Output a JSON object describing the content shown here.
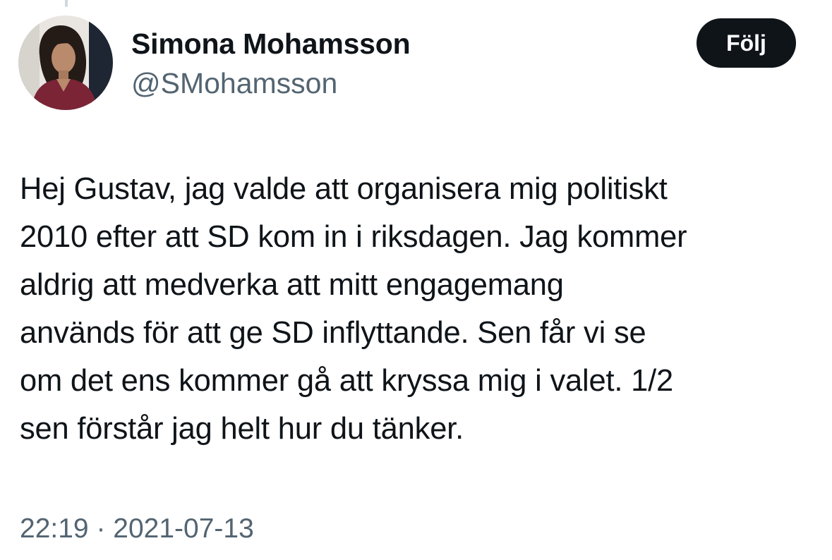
{
  "author": {
    "display_name": "Simona Mohamsson",
    "handle": "@SMohamsson"
  },
  "follow_button": {
    "label": "Följ"
  },
  "tweet": {
    "lines": [
      "Hej Gustav, jag valde att organisera mig politiskt",
      "2010 efter att SD kom in i riksdagen. Jag kommer",
      "aldrig att medverka att mitt engagemang",
      "används för att ge SD inflyttande. Sen får vi se",
      "om det ens kommer gå att kryssa mig i valet. 1/2",
      "sen förstår jag helt hur du tänker."
    ],
    "time": "22:19",
    "separator": "·",
    "date": "2021-07-13"
  },
  "colors": {
    "text_primary": "#0f1419",
    "text_secondary": "#536471",
    "button_bg": "#0f1419",
    "button_text": "#ffffff",
    "thread_line": "#cfd9de"
  }
}
